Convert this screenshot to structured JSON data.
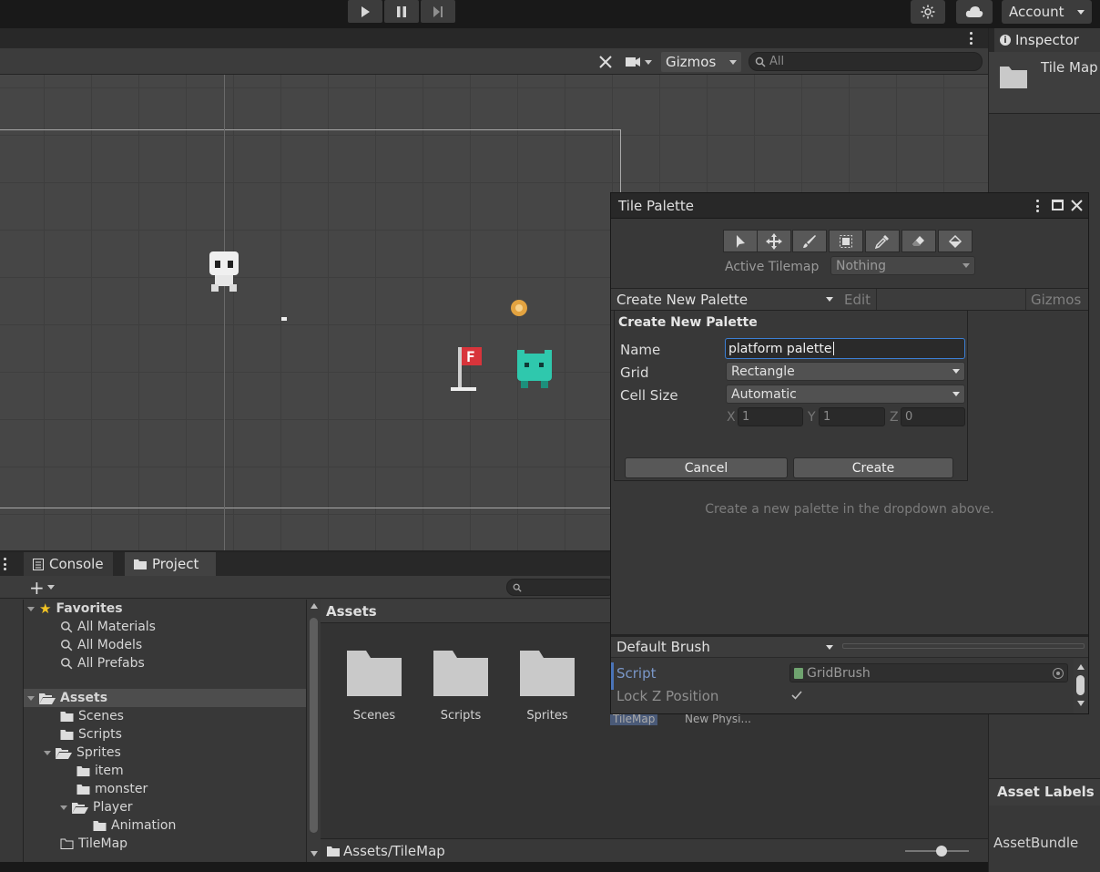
{
  "toolbar": {
    "play_icon": "play-icon",
    "pause_icon": "pause-icon",
    "step_icon": "step-icon",
    "settings_icon": "sun-settings-icon",
    "cloud_icon": "cloud-icon",
    "account_label": "Account"
  },
  "scene": {
    "gizmos_label": "Gizmos",
    "search_placeholder": "All"
  },
  "inspector": {
    "tab_label": "Inspector",
    "object_name": "Tile Map",
    "asset_labels": "Asset Labels",
    "asset_bundle": "AssetBundle"
  },
  "bottom": {
    "tabs": [
      {
        "label": "Console"
      },
      {
        "label": "Project"
      }
    ],
    "tree": {
      "favorites": "Favorites",
      "fav_items": [
        "All Materials",
        "All Models",
        "All Prefabs"
      ],
      "assets": "Assets",
      "asset_items": [
        "Scenes",
        "Scripts",
        "Sprites"
      ],
      "sprite_items": [
        "item",
        "monster",
        "Player"
      ],
      "player_items": [
        "Animation"
      ],
      "tilemap": "TileMap"
    },
    "grid": {
      "header": "Assets",
      "folders": [
        "Scenes",
        "Scripts",
        "Sprites"
      ],
      "partial_labels": [
        "TileMap",
        "New Physi..."
      ],
      "path": "Assets/TileMap"
    }
  },
  "tile_palette": {
    "title": "Tile Palette",
    "active_tilemap_label": "Active Tilemap",
    "active_tilemap_value": "Nothing",
    "palette_dropdown": "Create New Palette",
    "edit_label": "Edit",
    "gizmos_label": "Gizmos",
    "popup": {
      "title": "Create New Palette",
      "name_label": "Name",
      "name_value": "platform palette",
      "grid_label": "Grid",
      "grid_value": "Rectangle",
      "cell_size_label": "Cell Size",
      "cell_size_value": "Automatic",
      "x_label": "X",
      "x_value": "1",
      "y_label": "Y",
      "y_value": "1",
      "z_label": "Z",
      "z_value": "0",
      "cancel_label": "Cancel",
      "create_label": "Create"
    },
    "hint": "Create a new palette in the dropdown above.",
    "brush": {
      "dropdown": "Default Brush",
      "script_label": "Script",
      "script_value": "GridBrush",
      "lock_z_label": "Lock Z Position"
    }
  }
}
